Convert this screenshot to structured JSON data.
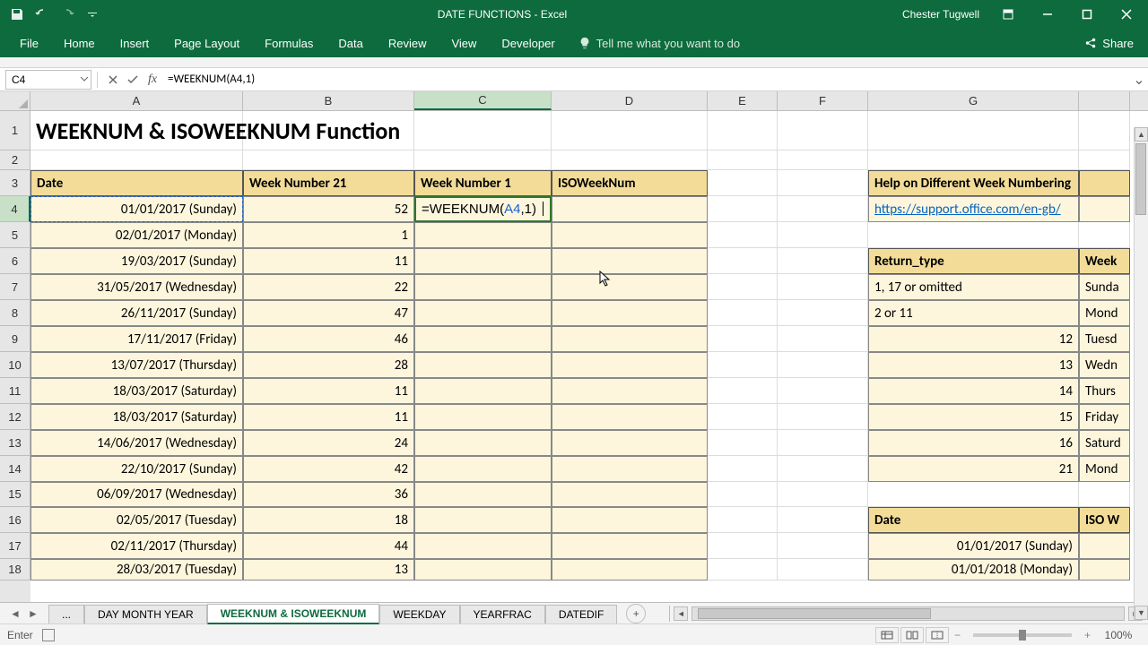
{
  "app": {
    "title": "DATE FUNCTIONS - Excel",
    "user": "Chester Tugwell"
  },
  "ribbon": {
    "tabs": [
      "File",
      "Home",
      "Insert",
      "Page Layout",
      "Formulas",
      "Data",
      "Review",
      "View",
      "Developer"
    ],
    "tell_me": "Tell me what you want to do",
    "share": "Share"
  },
  "name_box": "C4",
  "formula": "=WEEKNUM(A4,1)",
  "columns": [
    "A",
    "B",
    "C",
    "D",
    "E",
    "F",
    "G"
  ],
  "rows_visible": [
    "1",
    "2",
    "3",
    "4",
    "5",
    "6",
    "7",
    "8",
    "9",
    "10",
    "11",
    "12",
    "13",
    "14",
    "15",
    "16",
    "17",
    "18"
  ],
  "sheet": {
    "title": "WEEKNUM & ISOWEEKNUM Function",
    "headers": {
      "a": "Date",
      "b": "Week Number 21",
      "c": "Week Number 1",
      "d": "ISOWeekNum",
      "g": "Help on Different Week Numbering"
    },
    "help_url": "https://support.office.com/en-gb/",
    "data_rows": [
      {
        "date": "01/01/2017 (Sunday)",
        "wn21": "52"
      },
      {
        "date": "02/01/2017 (Monday)",
        "wn21": "1"
      },
      {
        "date": "19/03/2017 (Sunday)",
        "wn21": "11"
      },
      {
        "date": "31/05/2017 (Wednesday)",
        "wn21": "22"
      },
      {
        "date": "26/11/2017 (Sunday)",
        "wn21": "47"
      },
      {
        "date": "17/11/2017 (Friday)",
        "wn21": "46"
      },
      {
        "date": "13/07/2017 (Thursday)",
        "wn21": "28"
      },
      {
        "date": "18/03/2017 (Saturday)",
        "wn21": "11"
      },
      {
        "date": "18/03/2017 (Saturday)",
        "wn21": "11"
      },
      {
        "date": "14/06/2017 (Wednesday)",
        "wn21": "24"
      },
      {
        "date": "22/10/2017 (Sunday)",
        "wn21": "42"
      },
      {
        "date": "06/09/2017 (Wednesday)",
        "wn21": "36"
      },
      {
        "date": "02/05/2017 (Tuesday)",
        "wn21": "18"
      },
      {
        "date": "02/11/2017 (Thursday)",
        "wn21": "44"
      },
      {
        "date": "28/03/2017 (Tuesday)",
        "wn21": "13"
      }
    ],
    "edit_cell_display": {
      "prefix": "=WEEKNUM(",
      "ref": "A4",
      "rest": ",1",
      "close": ")"
    },
    "help_table": {
      "h1": "Return_type",
      "h2": "Week",
      "rows": [
        {
          "a": "1, 17 or omitted",
          "b": "Sunda"
        },
        {
          "a": "2 or 11",
          "b": "Mond"
        },
        {
          "a": "12",
          "b": "Tuesd",
          "right": true
        },
        {
          "a": "13",
          "b": "Wedn",
          "right": true
        },
        {
          "a": "14",
          "b": "Thurs",
          "right": true
        },
        {
          "a": "15",
          "b": "Friday",
          "right": true
        },
        {
          "a": "16",
          "b": "Saturd",
          "right": true
        },
        {
          "a": "21",
          "b": "Mond",
          "right": true
        }
      ]
    },
    "iso_table": {
      "h1": "Date",
      "h2": "ISO W",
      "rows": [
        "01/01/2017 (Sunday)",
        "01/01/2018 (Monday)"
      ]
    }
  },
  "sheet_tabs": {
    "ellipsis": "...",
    "tabs": [
      "DAY MONTH YEAR",
      "WEEKNUM & ISOWEEKNUM",
      "WEEKDAY",
      "YEARFRAC",
      "DATEDIF"
    ],
    "active": 1
  },
  "status": {
    "mode": "Enter",
    "zoom": "100%"
  }
}
